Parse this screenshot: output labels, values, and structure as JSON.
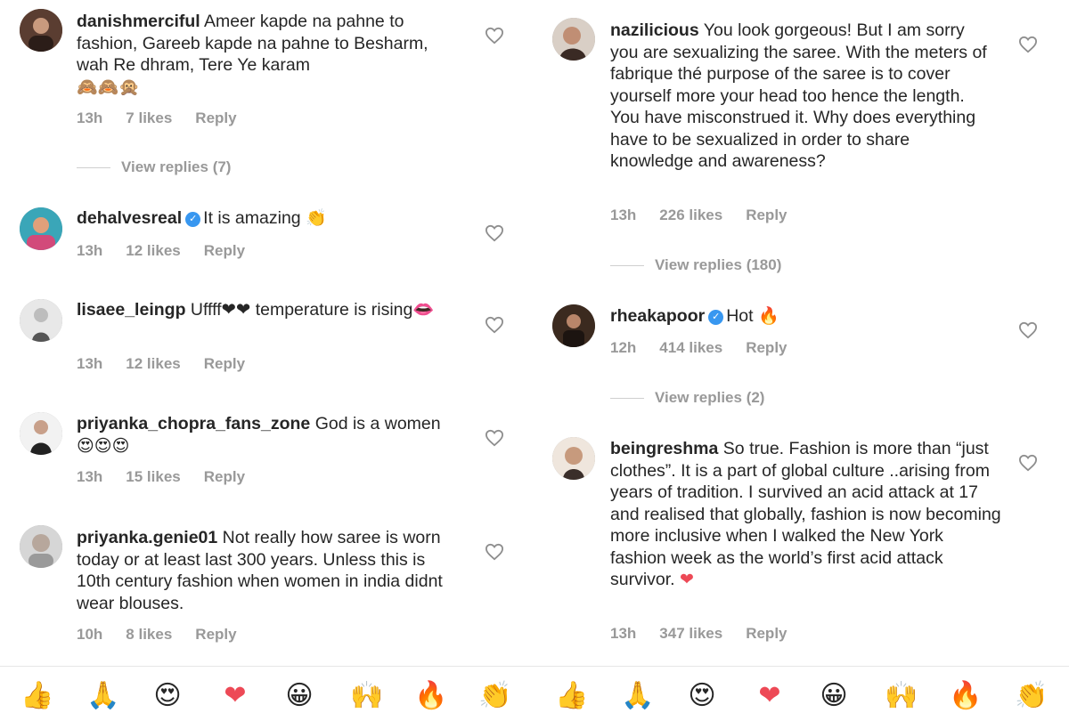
{
  "left_comments": [
    {
      "username": "danishmerciful",
      "verified": false,
      "text": "Ameer kapde na pahne to fashion, Gareeb kapde na pahne to Besharm, wah Re dhram, Tere Ye karam",
      "emojis": "🙈🙈🙊",
      "time": "13h",
      "likes": "7 likes",
      "reply_label": "Reply",
      "view_replies": "View replies (7)"
    },
    {
      "username": "dehalvesreal",
      "verified": true,
      "text": "It is amazing",
      "emojis": "👏",
      "time": "13h",
      "likes": "12 likes",
      "reply_label": "Reply"
    },
    {
      "username": "lisaee_leingp",
      "verified": false,
      "text": "Uffff❤❤ temperature is rising👄",
      "time": "13h",
      "likes": "12 likes",
      "reply_label": "Reply"
    },
    {
      "username": "priyanka_chopra_fans_zone",
      "verified": false,
      "text": "God is a women",
      "emojis": "😍😍😍",
      "time": "13h",
      "likes": "15 likes",
      "reply_label": "Reply"
    },
    {
      "username": "priyanka.genie01",
      "verified": false,
      "text": "Not really how saree is worn today or at least last 300 years. Unless this is 10th century fashion when women in india didnt wear blouses.",
      "time": "10h",
      "likes": "8 likes",
      "reply_label": "Reply"
    }
  ],
  "right_comments": [
    {
      "username": "nazilicious",
      "verified": false,
      "text": "You look gorgeous! But I am sorry you are sexualizing the saree. With the meters of fabrique thé purpose of the saree is to cover yourself more your head too hence the length. You have misconstrued it. Why does everything have to be sexualized in order to share knowledge and awareness?",
      "time": "13h",
      "likes": "226 likes",
      "reply_label": "Reply",
      "view_replies": "View replies (180)"
    },
    {
      "username": "rheakapoor",
      "verified": true,
      "text": "Hot",
      "emojis": "🔥",
      "time": "12h",
      "likes": "414 likes",
      "reply_label": "Reply",
      "view_replies": "View replies (2)"
    },
    {
      "username": "beingreshma",
      "verified": false,
      "text": "So true. Fashion is more than “just clothes”. It is a part of global culture ..arising from years of tradition. I survived an acid attack at 17 and realised that globally, fashion is now becoming more inclusive when I walked the New York fashion week as the world’s first acid attack survivor.",
      "emojis": "❤",
      "time": "13h",
      "likes": "347 likes",
      "reply_label": "Reply"
    }
  ],
  "emoji_bar": [
    "👍",
    "🙏",
    "😍",
    "❤",
    "😀",
    "🙌",
    "🔥",
    "👏",
    "👍",
    "🙏",
    "😍",
    "❤",
    "😀",
    "🙌",
    "🔥",
    "👏"
  ],
  "colors": {
    "text": "#262626",
    "meta": "#999999",
    "verified": "#3897f0",
    "heart_red": "#ed4956"
  }
}
